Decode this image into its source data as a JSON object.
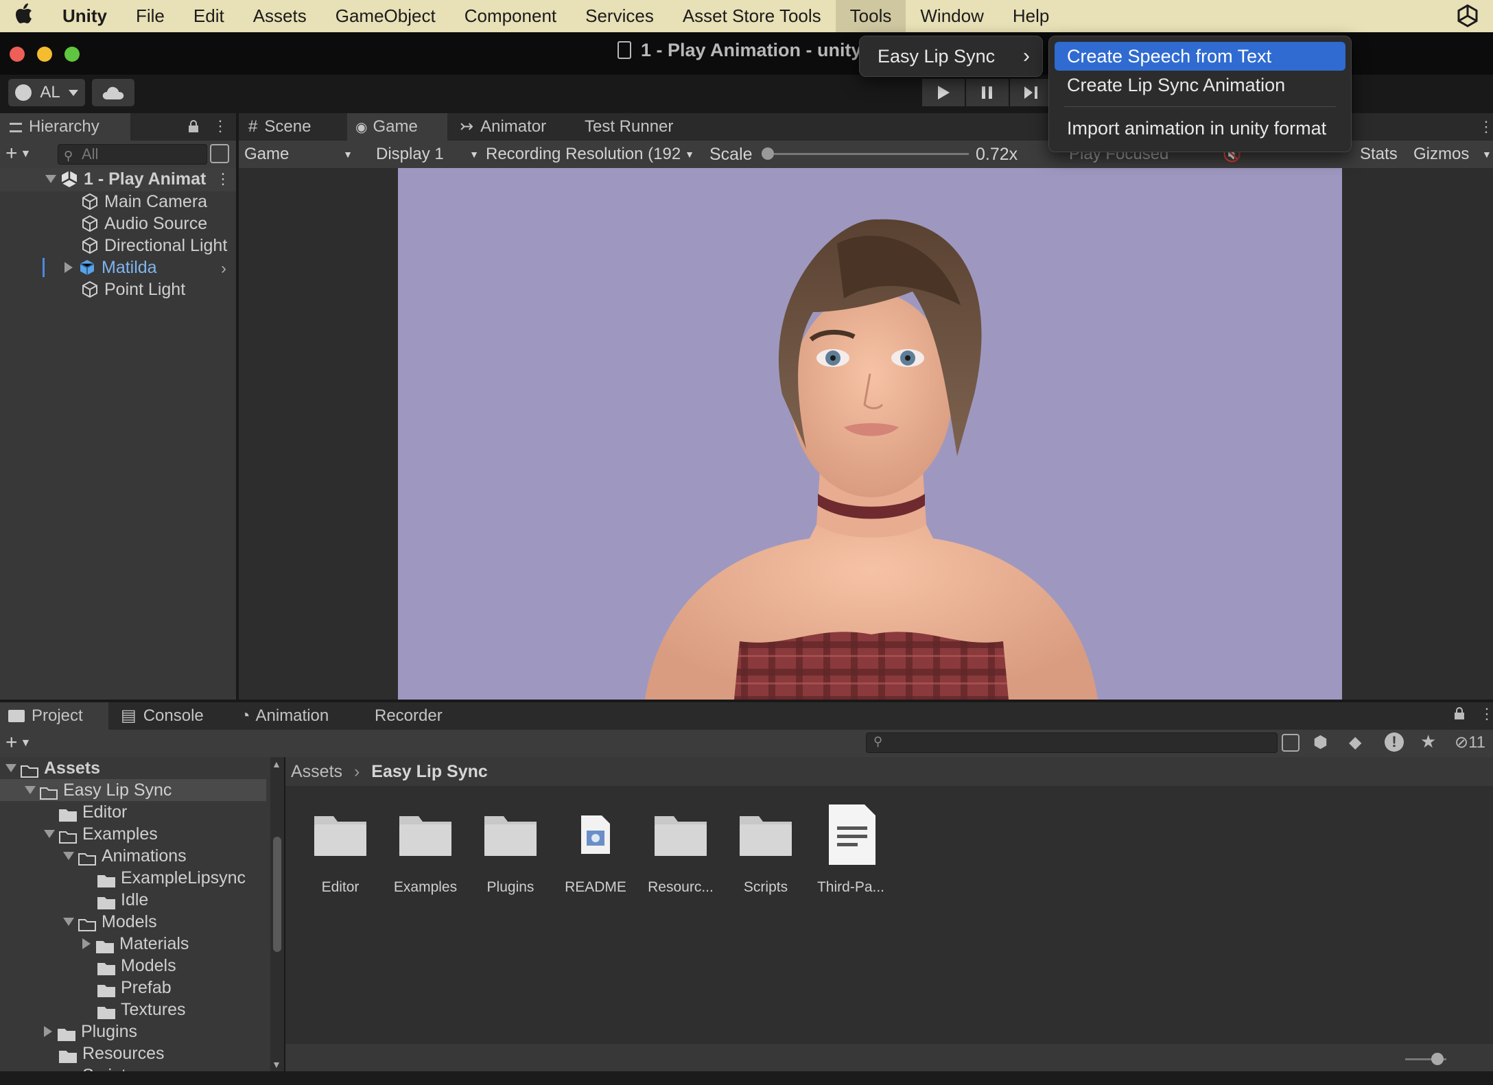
{
  "menubar": {
    "app": "Unity",
    "items": [
      "File",
      "Edit",
      "Assets",
      "GameObject",
      "Component",
      "Services",
      "Asset Store Tools",
      "Tools",
      "Window",
      "Help"
    ]
  },
  "window": {
    "title": "1 - Play Animation - unity"
  },
  "toolbar": {
    "account": "AL"
  },
  "menus": {
    "tools_submenu": {
      "item": "Easy Lip Sync"
    },
    "easy_lip_sync": [
      "Create Speech from Text",
      "Create Lip Sync Animation",
      "Import animation in unity format"
    ]
  },
  "hierarchy": {
    "tab": "Hierarchy",
    "search_placeholder": "All",
    "scene": "1 - Play Animat",
    "items": [
      "Main Camera",
      "Audio Source",
      "Directional Light",
      "Matilda",
      "Point Light"
    ]
  },
  "view_tabs": [
    "Scene",
    "Game",
    "Animator",
    "Test Runner"
  ],
  "game_bar": {
    "view": "Game",
    "display": "Display 1",
    "resolution": "Recording Resolution (192",
    "scale_label": "Scale",
    "scale_value": "0.72x",
    "scale_fraction": 0.0,
    "play_mode": "Play Focused",
    "stats": "Stats",
    "gizmos": "Gizmos"
  },
  "bottom_tabs": [
    "Project",
    "Console",
    "Animation",
    "Recorder"
  ],
  "project": {
    "hidden_count": "11",
    "breadcrumb": [
      "Assets",
      "Easy Lip Sync"
    ],
    "tree": [
      {
        "label": "Assets",
        "depth": 0,
        "arrow": "down",
        "bold": true
      },
      {
        "label": "Easy Lip Sync",
        "depth": 1,
        "arrow": "down"
      },
      {
        "label": "Editor",
        "depth": 2,
        "arrow": "none"
      },
      {
        "label": "Examples",
        "depth": 2,
        "arrow": "down"
      },
      {
        "label": "Animations",
        "depth": 3,
        "arrow": "down"
      },
      {
        "label": "ExampleLipsync",
        "depth": 4,
        "arrow": "none"
      },
      {
        "label": "Idle",
        "depth": 4,
        "arrow": "none"
      },
      {
        "label": "Models",
        "depth": 3,
        "arrow": "down"
      },
      {
        "label": "Materials",
        "depth": 4,
        "arrow": "right"
      },
      {
        "label": "Models",
        "depth": 4,
        "arrow": "none"
      },
      {
        "label": "Prefab",
        "depth": 4,
        "arrow": "none"
      },
      {
        "label": "Textures",
        "depth": 4,
        "arrow": "none"
      },
      {
        "label": "Plugins",
        "depth": 2,
        "arrow": "right"
      },
      {
        "label": "Resources",
        "depth": 2,
        "arrow": "none"
      },
      {
        "label": "Scripts",
        "depth": 2,
        "arrow": "down"
      }
    ],
    "grid": [
      {
        "label": "Editor",
        "kind": "folder"
      },
      {
        "label": "Examples",
        "kind": "folder"
      },
      {
        "label": "Plugins",
        "kind": "folder"
      },
      {
        "label": "README",
        "kind": "asset"
      },
      {
        "label": "Resourc...",
        "kind": "folder"
      },
      {
        "label": "Scripts",
        "kind": "folder"
      },
      {
        "label": "Third-Pa...",
        "kind": "document"
      }
    ]
  },
  "colors": {
    "accent": "#2f6bd0",
    "menubar": "#e8e0b6",
    "game_bg": "#9e98c0",
    "panel": "#383838"
  }
}
